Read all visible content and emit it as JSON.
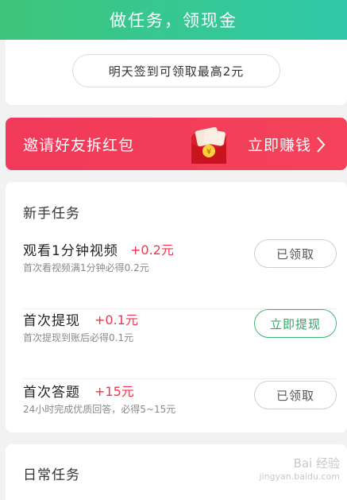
{
  "header": {
    "title": "做任务，领现金"
  },
  "signin": {
    "text": "明天签到可领取最高2元"
  },
  "invite": {
    "title": "邀请好友拆红包",
    "cta": "立即赚钱",
    "packet_symbol": "¥"
  },
  "newbie": {
    "title": "新手任务",
    "tasks": [
      {
        "name": "观看1分钟视频",
        "reward": "+0.2元",
        "desc": "首次看视频满1分钟必得0.2元",
        "button": "已领取",
        "state": "claimed"
      },
      {
        "name": "首次提现",
        "reward": "+0.1元",
        "desc": "首次提现到账后必得0.1元",
        "button": "立即提现",
        "state": "active"
      },
      {
        "name": "首次答题",
        "reward": "+15元",
        "desc": "24小时完成优质回答，必得5~15元",
        "button": "已领取",
        "state": "claimed"
      }
    ]
  },
  "daily": {
    "title": "日常任务"
  },
  "watermark": {
    "line1": "Bai 经验",
    "line2": "jingyan.baidu.com"
  },
  "colors": {
    "header_green": "#3ec57a",
    "banner_red": "#f1395a",
    "reward_red": "#f0344e",
    "active_green": "#2ea866"
  }
}
